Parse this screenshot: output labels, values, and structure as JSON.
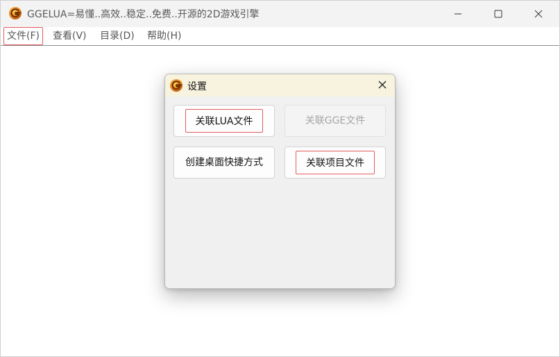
{
  "window": {
    "title": "GGELUA=易懂..高效..稳定..免费..开源的2D游戏引擎",
    "app_icon": "ggelua-logo-icon",
    "controls": {
      "minimize_icon": "minimize-icon",
      "maximize_icon": "maximize-icon",
      "close_icon": "close-icon"
    }
  },
  "menubar": {
    "items": [
      {
        "label": "文件(F)"
      },
      {
        "label": "查看(V)"
      },
      {
        "label": "目录(D)"
      },
      {
        "label": "帮助(H)"
      }
    ]
  },
  "dialog": {
    "title": "设置",
    "close_icon": "close-icon",
    "buttons": {
      "associate_lua": "关联LUA文件",
      "associate_gge": "关联GGE文件",
      "create_shortcut": "创建桌面快捷方式",
      "associate_project": "关联项目文件"
    }
  },
  "colors": {
    "highlight_border": "#e25b5b",
    "dialog_title_bg": "#f7f3df",
    "disabled_text": "#a5a5a5",
    "titlebar_bg": "#f3f3f3"
  }
}
